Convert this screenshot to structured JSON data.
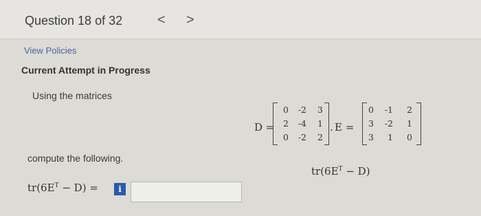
{
  "header": {
    "title": "Question 18 of 32",
    "prev_icon": "chevron-left-icon",
    "prev": "<",
    "next_icon": "chevron-right-icon",
    "next": ">"
  },
  "links": {
    "view_policies": "View Policies"
  },
  "status": "Current Attempt in Progress",
  "prompt": {
    "intro": "Using the matrices",
    "compute": "compute the following."
  },
  "matrices": {
    "D": {
      "label": "D =",
      "rows": [
        [
          "0",
          "-2",
          "3"
        ],
        [
          "2",
          "-4",
          "1"
        ],
        [
          "0",
          "-2",
          "2"
        ]
      ]
    },
    "separator": ".",
    "E": {
      "label": "E =",
      "rows": [
        [
          "0",
          "-1",
          "2"
        ],
        [
          "3",
          "-2",
          "1"
        ],
        [
          "3",
          "1",
          "0"
        ]
      ]
    }
  },
  "expression": "tr(6E",
  "expression_sup": "T",
  "expression_tail": " − D)",
  "answer": {
    "equals": "=",
    "info_label": "i",
    "value": ""
  },
  "colors": {
    "info_button": "#2a5aa8",
    "link": "#4b63a0"
  }
}
